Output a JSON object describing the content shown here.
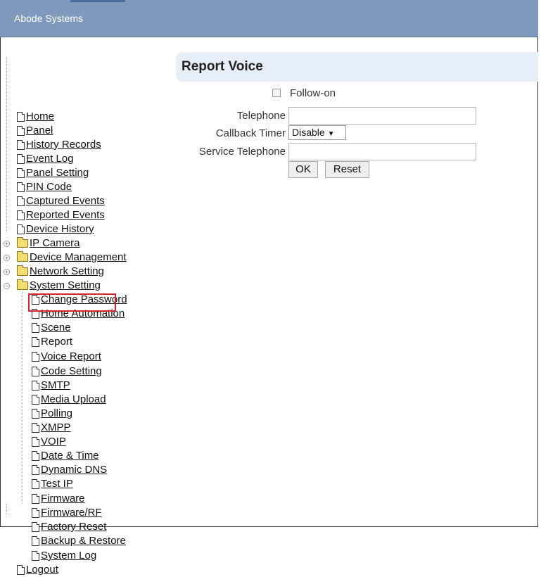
{
  "app": {
    "title": "Abode Systems"
  },
  "nav": {
    "home": "Home",
    "panel": "Panel",
    "history_records": "History Records",
    "event_log": "Event Log",
    "panel_setting": "Panel Setting",
    "pin_code": "PIN Code",
    "captured_events": "Captured Events",
    "reported_events": "Reported Events",
    "device_history": "Device History",
    "ip_camera": "IP Camera",
    "device_management": "Device Management",
    "network_setting": "Network Setting",
    "system_setting": "System Setting",
    "system_children": [
      "Change Password",
      "Home Automation",
      "Scene",
      "Report",
      "Voice Report",
      "Code Setting",
      "SMTP",
      "Media Upload",
      "Polling",
      "XMPP",
      "VOIP",
      "Date & Time",
      "Dynamic DNS",
      "Test IP",
      "Firmware",
      "Firmware/RF",
      "Factory Reset",
      "Backup & Restore",
      "System Log"
    ],
    "logout": "Logout",
    "selected": "Voice Report"
  },
  "page": {
    "title": "Report Voice",
    "follow_on_label": "Follow-on",
    "follow_on_checked": false,
    "telephone_label": "Telephone",
    "telephone_value": "",
    "callback_timer_label": "Callback Timer",
    "callback_timer_value": "Disable",
    "callback_timer_arrow": "▼",
    "service_telephone_label": "Service Telephone",
    "service_telephone_value": "",
    "ok_label": "OK",
    "reset_label": "Reset"
  },
  "colors": {
    "header_bg": "#7f99bc",
    "highlight_border": "#d9232d",
    "title_bar_bg": "#e6eff8"
  }
}
